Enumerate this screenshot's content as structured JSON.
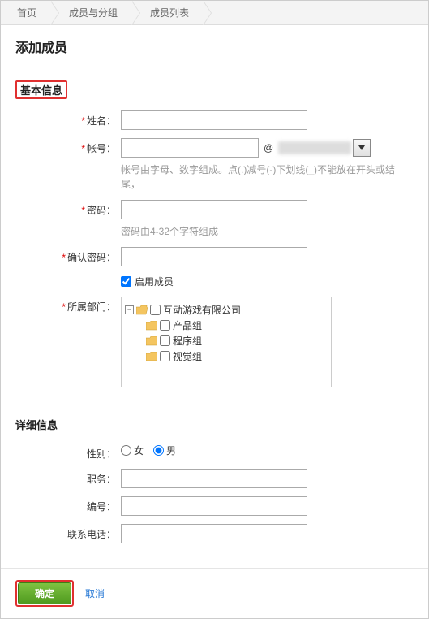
{
  "breadcrumb": {
    "home": "首页",
    "members_groups": "成员与分组",
    "member_list": "成员列表"
  },
  "page_title": "添加成员",
  "sections": {
    "basic": "基本信息",
    "detail": "详细信息"
  },
  "labels": {
    "name": "姓名：",
    "account": "帐号：",
    "password": "密码：",
    "confirm": "确认密码：",
    "enable": "启用成员",
    "dept": "所属部门：",
    "gender": "性别：",
    "position": "职务：",
    "code": "编号：",
    "phone": "联系电话："
  },
  "hints": {
    "account": "帐号由字母、数字组成。点(.)减号(-)下划线(_)不能放在开头或结尾，",
    "password": "密码由4-32个字符组成"
  },
  "account_at": "@",
  "gender": {
    "female": "女",
    "male": "男"
  },
  "tree": {
    "root": "互动游戏有限公司",
    "children": [
      "产品组",
      "程序组",
      "视觉组"
    ]
  },
  "buttons": {
    "ok": "确定",
    "cancel": "取消"
  },
  "toggle_minus": "−"
}
